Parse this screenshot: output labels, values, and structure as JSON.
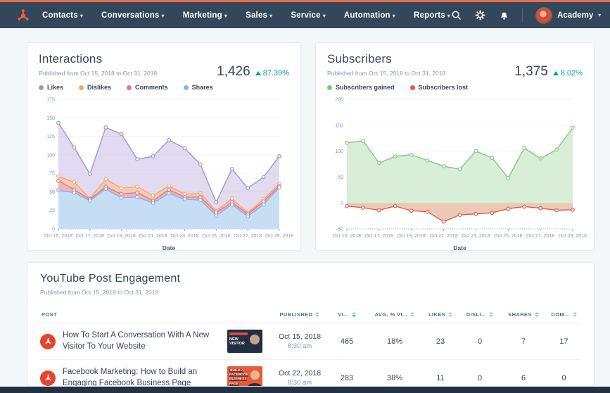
{
  "nav": {
    "menu": [
      {
        "label": "Contacts"
      },
      {
        "label": "Conversations"
      },
      {
        "label": "Marketing"
      },
      {
        "label": "Sales"
      },
      {
        "label": "Service"
      },
      {
        "label": "Automation"
      },
      {
        "label": "Reports"
      }
    ],
    "account_label": "Academy",
    "colors": {
      "bar_bg": "#33475b",
      "accent": "#e66e50",
      "logo": "#ff5c35"
    }
  },
  "interactions": {
    "title": "Interactions",
    "subtitle": "Published from Oct 15, 2018 to Oct 31, 2018",
    "total": "1,426",
    "delta": "87.39%",
    "delta_color": "#00a38d",
    "legend": [
      {
        "label": "Likes",
        "color": "#9a9bc1"
      },
      {
        "label": "Dislikes",
        "color": "#f5a75f"
      },
      {
        "label": "Comments",
        "color": "#f1708c"
      },
      {
        "label": "Shares",
        "color": "#7fb3e8"
      }
    ]
  },
  "subscribers": {
    "title": "Subscribers",
    "subtitle": "Published from Oct 15, 2018 to Oct 31, 2018",
    "total": "1,375",
    "delta": "8.02%",
    "delta_color": "#00a38d",
    "legend": [
      {
        "label": "Subscribers gained",
        "color": "#81c784"
      },
      {
        "label": "Subscribers lost",
        "color": "#e15b4c"
      }
    ]
  },
  "engagement": {
    "title": "YouTube Post Engagement",
    "subtitle": "Published from Oct 15, 2018 to Oct 31, 2018",
    "columns": [
      "POST",
      "PUBLISHED",
      "VI...",
      "AVG. % VI...",
      "LIKES",
      "DISLI...",
      "SHARES",
      "COM..."
    ],
    "sorted": {
      "column": "VI...",
      "direction": "desc",
      "active_color": "#00bcd4"
    },
    "rows": [
      {
        "title": "How To Start A Conversation With A New Visitor To Your Website",
        "thumb_label": "NEW VISITOR",
        "date": "Oct 15, 2018",
        "time": "8:30 am",
        "views": "465",
        "avg_pct_viewed": "18%",
        "likes": "23",
        "dislikes": "0",
        "shares": "7",
        "comments": "17"
      },
      {
        "title": "Facebook Marketing: How to Build an Engaging Facebook Business Page",
        "thumb_label": "BUILD A FACEBOOK BUSINESS PAGE",
        "date": "Oct 22, 2018",
        "time": "8:30 am",
        "views": "283",
        "avg_pct_viewed": "38%",
        "likes": "11",
        "dislikes": "0",
        "shares": "6",
        "comments": "0"
      }
    ]
  },
  "chart_data": [
    {
      "type": "area",
      "title": "Interactions",
      "xlabel": "Date",
      "ylim": [
        0,
        175
      ],
      "yticks": [
        0,
        25,
        50,
        75,
        100,
        125,
        150,
        175
      ],
      "x": [
        "Oct 15, 2018",
        "Oct 16, 2018",
        "Oct 17, 2018",
        "Oct 18, 2018",
        "Oct 19, 2018",
        "Oct 20, 2018",
        "Oct 21, 2018",
        "Oct 22, 2018",
        "Oct 23, 2018",
        "Oct 24, 2018",
        "Oct 25, 2018",
        "Oct 26, 2018",
        "Oct 27, 2018",
        "Oct 28, 2018",
        "Oct 29, 2018"
      ],
      "legend_position": "top",
      "grid": true,
      "series": [
        {
          "name": "Likes",
          "color": "#9a9bc1",
          "fill": "#b49ddb",
          "fill_opacity": 0.38,
          "values": [
            143,
            110,
            74,
            137,
            128,
            94,
            98,
            120,
            109,
            87,
            36,
            81,
            55,
            70,
            98
          ]
        },
        {
          "name": "Dislikes",
          "color": "#f5a75f",
          "fill": "#f7c489",
          "fill_opacity": 0.55,
          "values": [
            71,
            63,
            41,
            67,
            55,
            57,
            45,
            58,
            47,
            48,
            24,
            41,
            22,
            40,
            61
          ]
        },
        {
          "name": "Comments",
          "color": "#f1708c",
          "fill": "#f59ab0",
          "fill_opacity": 0.5,
          "values": [
            65,
            53,
            40,
            57,
            47,
            49,
            38,
            53,
            43,
            43,
            22,
            36,
            20,
            37,
            58
          ]
        },
        {
          "name": "Shares",
          "color": "#7fb3e8",
          "fill": "#c3e0f7",
          "fill_opacity": 0.95,
          "values": [
            52,
            49,
            38,
            54,
            42,
            43,
            35,
            48,
            40,
            39,
            18,
            33,
            17,
            33,
            56
          ]
        }
      ]
    },
    {
      "type": "area",
      "title": "Subscribers",
      "xlabel": "Date",
      "ylim": [
        -50,
        200
      ],
      "yticks": [
        -50,
        0,
        50,
        100,
        150,
        200
      ],
      "x": [
        "Oct 15, 2018",
        "Oct 16, 2018",
        "Oct 17, 2018",
        "Oct 18, 2018",
        "Oct 19, 2018",
        "Oct 20, 2018",
        "Oct 21, 2018",
        "Oct 22, 2018",
        "Oct 23, 2018",
        "Oct 24, 2018",
        "Oct 25, 2018",
        "Oct 26, 2018",
        "Oct 27, 2018",
        "Oct 28, 2018",
        "Oct 29, 2018"
      ],
      "legend_position": "top",
      "grid": true,
      "series": [
        {
          "name": "Subscribers gained",
          "color": "#81c784",
          "fill": "#c9e7c4",
          "fill_opacity": 0.7,
          "values": [
            116,
            120,
            77,
            90,
            93,
            82,
            71,
            65,
            100,
            87,
            48,
            106,
            86,
            103,
            145
          ]
        },
        {
          "name": "Subscribers lost",
          "color": "#e15b4c",
          "fill": "#d99e78",
          "fill_opacity": 0.55,
          "values": [
            -6,
            -9,
            -14,
            -6,
            -15,
            -17,
            -36,
            -23,
            -21,
            -19,
            -11,
            -7,
            -10,
            -14,
            -13
          ]
        }
      ]
    }
  ]
}
